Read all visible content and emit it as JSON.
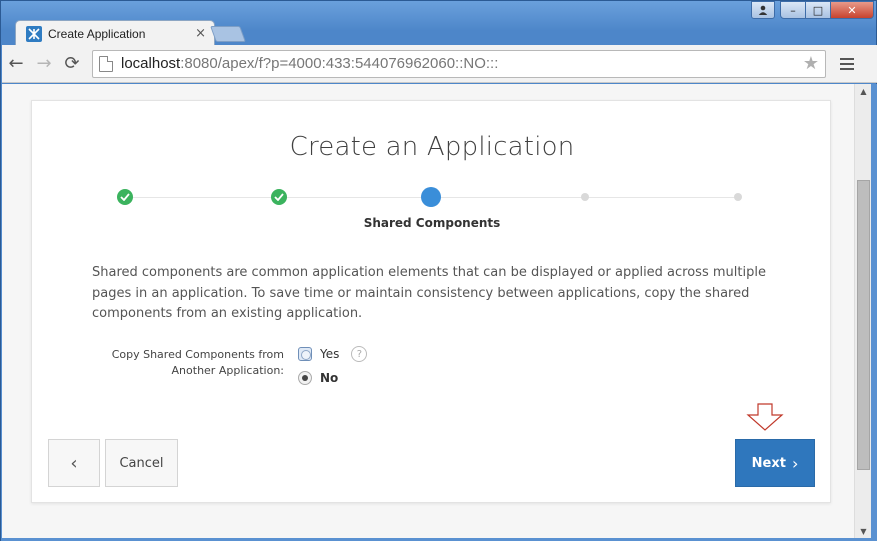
{
  "browser": {
    "tab_title": "Create Application",
    "tab_close": "×",
    "url_host": "localhost",
    "url_rest": ":8080/apex/f?p=4000:433:544076962060::NO:::",
    "back_icon": "←",
    "forward_icon": "→",
    "reload_icon": "⟳",
    "star_icon": "★",
    "window_min": "–",
    "window_max": "□",
    "window_close": "✕",
    "user_icon": "●"
  },
  "page": {
    "title": "Create an Application",
    "steps": [
      {
        "state": "done"
      },
      {
        "state": "done"
      },
      {
        "state": "current"
      },
      {
        "state": "future"
      },
      {
        "state": "future"
      }
    ],
    "current_step_label": "Shared Components",
    "description": "Shared components are common application elements that can be displayed or applied across multiple pages in an application. To save time or maintain consistency between applications, copy the shared components from an existing application.",
    "field_label_line1": "Copy Shared Components from",
    "field_label_line2": "Another Application:",
    "option_yes": "Yes",
    "option_no": "No",
    "selected_option": "No",
    "help_icon": "?",
    "back_button": "‹",
    "cancel_button": "Cancel",
    "next_button": "Next",
    "next_chevron": "›"
  },
  "colors": {
    "primary": "#2f77bd",
    "step_done": "#3bb35e",
    "step_current": "#3a8ed9",
    "annotation_arrow": "#c0392b"
  }
}
